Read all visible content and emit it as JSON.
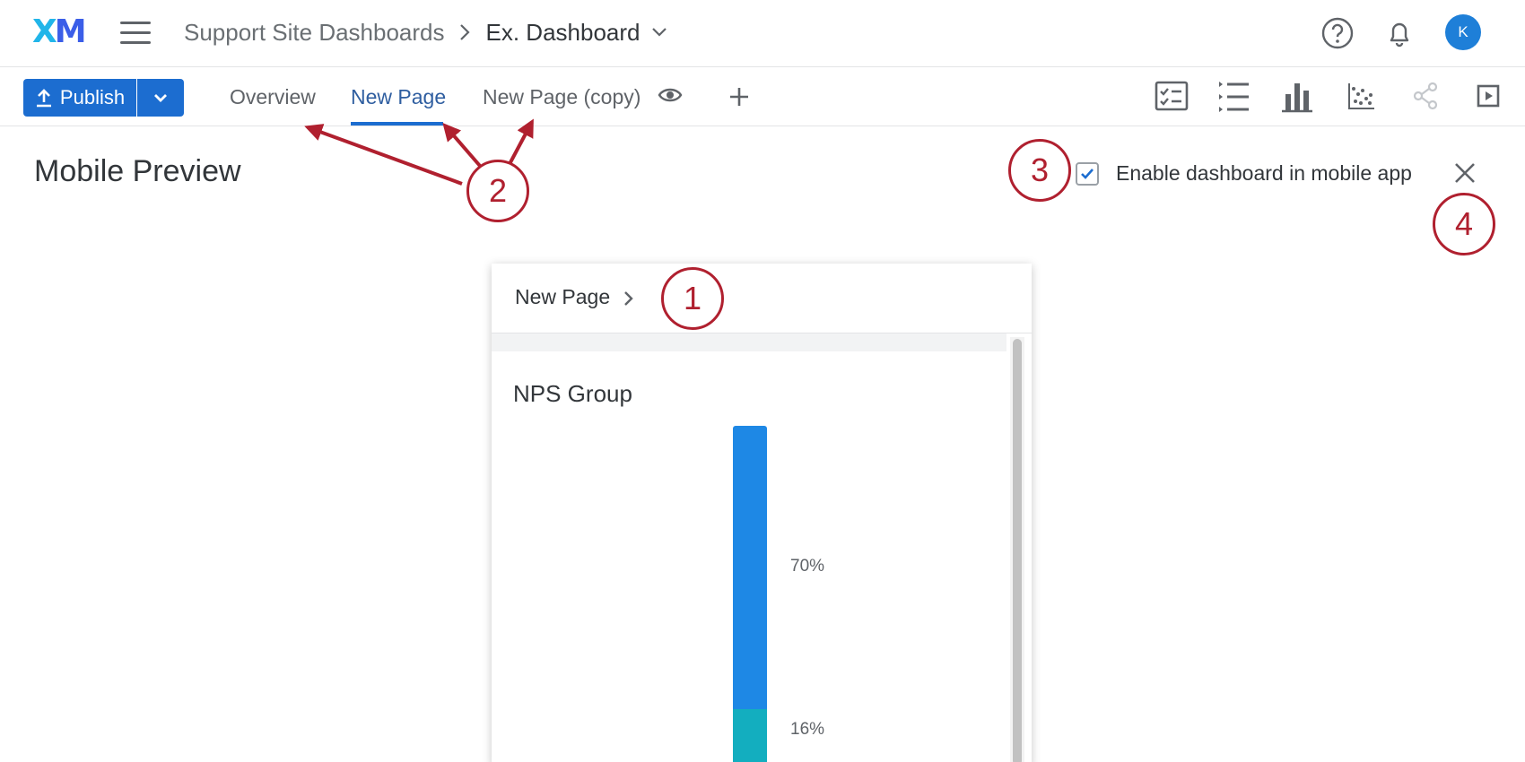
{
  "header": {
    "logo": {
      "x": "X",
      "m": "M"
    },
    "breadcrumb": {
      "parent": "Support Site Dashboards",
      "current": "Ex. Dashboard"
    },
    "avatar_initial": "K",
    "icons": [
      "menu-icon",
      "help-icon",
      "bell-icon"
    ]
  },
  "toolbar": {
    "publish_label": "Publish",
    "tabs": [
      {
        "label": "Overview"
      },
      {
        "label": "New Page",
        "active": true
      },
      {
        "label": "New Page (copy)"
      }
    ],
    "right_icons": [
      "checklist-icon",
      "list-icon",
      "bar-chart-icon",
      "scatter-icon",
      "share-icon",
      "present-icon"
    ]
  },
  "preview": {
    "title": "Mobile Preview",
    "enable_label": "Enable dashboard in mobile app",
    "enable_checked": true
  },
  "phone": {
    "page_title": "New Page",
    "widget_title": "NPS Group"
  },
  "chart_data": {
    "type": "bar",
    "stacked": true,
    "title": "NPS Group",
    "series": [
      {
        "value_label": "70%",
        "value": 70,
        "color": "#1e88e5"
      },
      {
        "value_label": "16%",
        "value": 16,
        "color": "#13aebf"
      }
    ]
  },
  "annotations": [
    "1",
    "2",
    "3",
    "4"
  ],
  "colors": {
    "brand_blue": "#1c6dd0",
    "annotation_red": "#b0202f"
  }
}
